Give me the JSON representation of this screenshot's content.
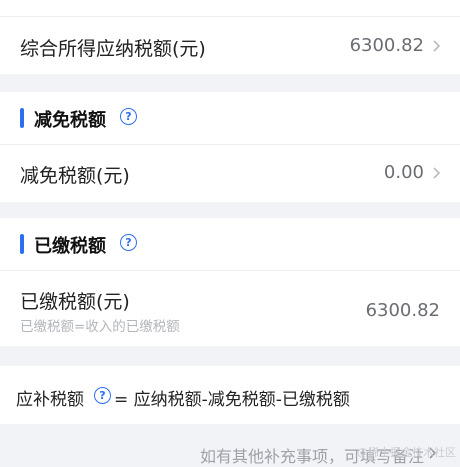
{
  "total_tax": {
    "label": "综合所得应纳税额(元)",
    "value": "6300.82"
  },
  "reduction_section": {
    "title": "减免税额",
    "help_glyph": "?",
    "row_label": "减免税额(元)",
    "row_value": "0.00"
  },
  "paid_section": {
    "title": "已缴税额",
    "help_glyph": "?",
    "row_label": "已缴税额(元)",
    "row_sub": "已缴税额=收入的已缴税额",
    "row_value": "6300.82"
  },
  "formula": {
    "label": "应补税额",
    "help_glyph": "?",
    "text": "= 应纳税额-减免税额-已缴税额"
  },
  "footer": {
    "note": "如有其他补充事项，可填写备注",
    "watermark": "@稀土掘金技术社区"
  },
  "colors": {
    "accent": "#2d6ff0",
    "background": "#f2f3f7",
    "card": "#ffffff",
    "muted_text": "#b3b6bd",
    "value_text": "#6a6d73"
  },
  "icons": {
    "chevron": "chevron-right-icon",
    "help": "question-circle-icon"
  }
}
